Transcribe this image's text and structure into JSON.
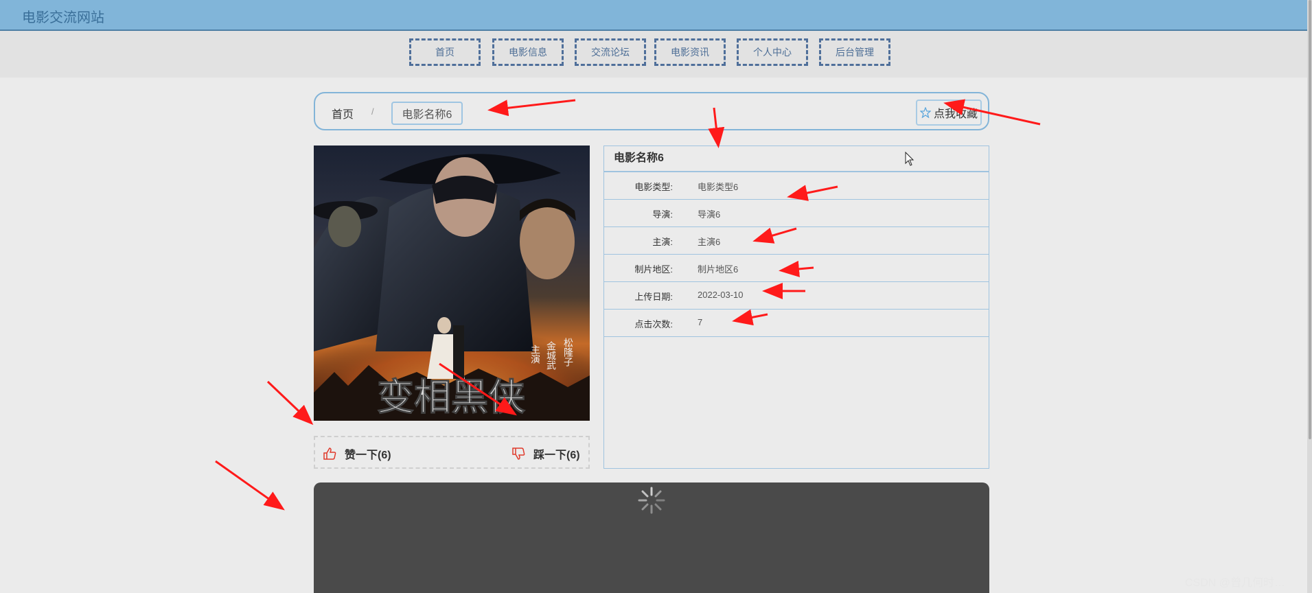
{
  "header": {
    "site_title": "电影交流网站"
  },
  "nav": {
    "items": [
      {
        "label": "首页"
      },
      {
        "label": "电影信息"
      },
      {
        "label": "交流论坛"
      },
      {
        "label": "电影资讯"
      },
      {
        "label": "个人中心"
      },
      {
        "label": "后台管理"
      }
    ]
  },
  "breadcrumb": {
    "home": "首页",
    "separator": "/",
    "current": "电影名称6",
    "favorite_label": "点我收藏"
  },
  "poster": {
    "title_text": "变相黑侠",
    "cast_text": [
      "主演",
      "金城武",
      "松隆子"
    ]
  },
  "votes": {
    "like_label": "赞一下(6)",
    "dislike_label": "踩一下(6)"
  },
  "movie": {
    "title": "电影名称6",
    "fields": [
      {
        "label": "电影类型:",
        "value": "电影类型6"
      },
      {
        "label": "导演:",
        "value": "导演6"
      },
      {
        "label": "主演:",
        "value": "主演6"
      },
      {
        "label": "制片地区:",
        "value": "制片地区6"
      },
      {
        "label": "上传日期:",
        "value": "2022-03-10"
      },
      {
        "label": "点击次数:",
        "value": "7"
      }
    ]
  },
  "watermark": "CSDN @曾几何时…",
  "colors": {
    "header_bg": "#81b5d9",
    "nav_border": "#4f6f9a",
    "panel_border": "#9fc3df",
    "annotation_arrow": "#ff1a1a",
    "video_bg": "#4a4a4a"
  }
}
